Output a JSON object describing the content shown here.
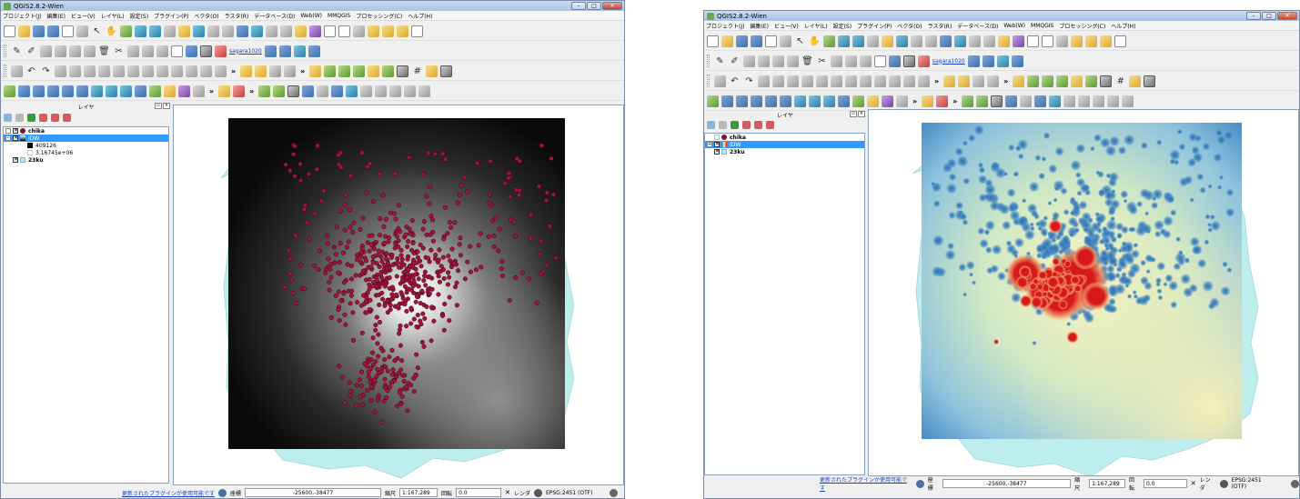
{
  "windows": [
    {
      "title": "QGIS2.8.2-Wien",
      "menus": [
        "プロジェクト(J)",
        "編集(E)",
        "ビュー(V)",
        "レイヤ(L)",
        "設定(S)",
        "プラグイン(P)",
        "ベクタ(O)",
        "ラスタ(R)",
        "データベース(D)",
        "Web(W)",
        "MMQGIS",
        "プロセッシング(C)",
        "ヘルプ(H)"
      ],
      "plugin_label": "sagara1020",
      "layer_panel_title": "レイヤ",
      "layers": [
        {
          "name": "chika",
          "checked": true,
          "symbol": "point"
        },
        {
          "name": "IDW",
          "checked": true,
          "selected": true,
          "symbol": "raster"
        },
        {
          "name": "409126",
          "legend": true,
          "swatch": "#000000"
        },
        {
          "name": "3.16745e+06",
          "legend": true,
          "swatch": "#ffffff"
        },
        {
          "name": "23ku",
          "checked": true,
          "symbol": "polygon"
        }
      ],
      "status": {
        "plugin_notice": "更新されたプラグインが使用可能です",
        "coord_label": "座標",
        "coord_value": "-25600,-38477",
        "scale_label": "縮尺",
        "scale_value": "1:167,289",
        "rotation_label": "回転",
        "rotation_value": "0.0",
        "render_label": "レンダ",
        "crs": "EPSG:2451 (OTF)"
      },
      "render_style": "grayscale"
    },
    {
      "title": "QGIS2.8.2-Wien",
      "menus": [
        "プロジェクト(J)",
        "編集(E)",
        "ビュー(V)",
        "レイヤ(L)",
        "設定(S)",
        "プラグイン(P)",
        "ベクタ(O)",
        "ラスタ(R)",
        "データベース(D)",
        "Web(W)",
        "MMQGIS",
        "プロセッシング(C)",
        "ヘルプ(H)"
      ],
      "plugin_label": "sagara1020",
      "layer_panel_title": "レイヤ",
      "layers": [
        {
          "name": "chika",
          "checked": false,
          "symbol": "point"
        },
        {
          "name": "IDW",
          "checked": true,
          "selected": true,
          "symbol": "raster"
        },
        {
          "name": "23ku",
          "checked": true,
          "symbol": "polygon"
        }
      ],
      "status": {
        "plugin_notice": "更新されたプラグインが使用可能です",
        "coord_label": "座標",
        "coord_value": "-25600,-38477",
        "scale_label": "縮尺",
        "scale_value": "1:167,289",
        "rotation_label": "回転",
        "rotation_value": "0.0",
        "render_label": "レンダ",
        "crs": "EPSG:2451 (OTF)"
      },
      "render_style": "spectral"
    }
  ]
}
